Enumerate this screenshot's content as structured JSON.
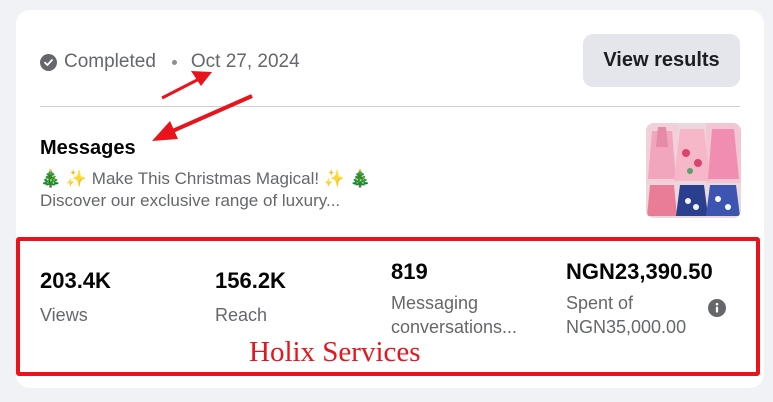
{
  "card": {
    "status": {
      "icon": "check-circle-icon",
      "text": "Completed"
    },
    "date": "Oct 27, 2024",
    "view_results_label": "View results",
    "message": {
      "title": "Messages",
      "line1": "🎄 ✨ Make This Christmas Magical! ✨ 🎄",
      "line2": "Discover our exclusive range of luxury..."
    },
    "thumbnail": {
      "icon": "dress-collage-image"
    }
  },
  "stats": [
    {
      "value": "203.4K",
      "label": "Views"
    },
    {
      "value": "156.2K",
      "label": "Reach"
    },
    {
      "value": "819",
      "label_line1": "Messaging",
      "label_line2": "conversations..."
    },
    {
      "value": "NGN23,390.50",
      "label_line1": "Spent of",
      "label_line2": "NGN35,000.00"
    }
  ],
  "info_icon": "info-icon",
  "watermark": "Holix Services",
  "colors": {
    "highlight_red": "#e8141c",
    "muted_text": "#65676b",
    "button_bg": "#e4e6eb"
  }
}
